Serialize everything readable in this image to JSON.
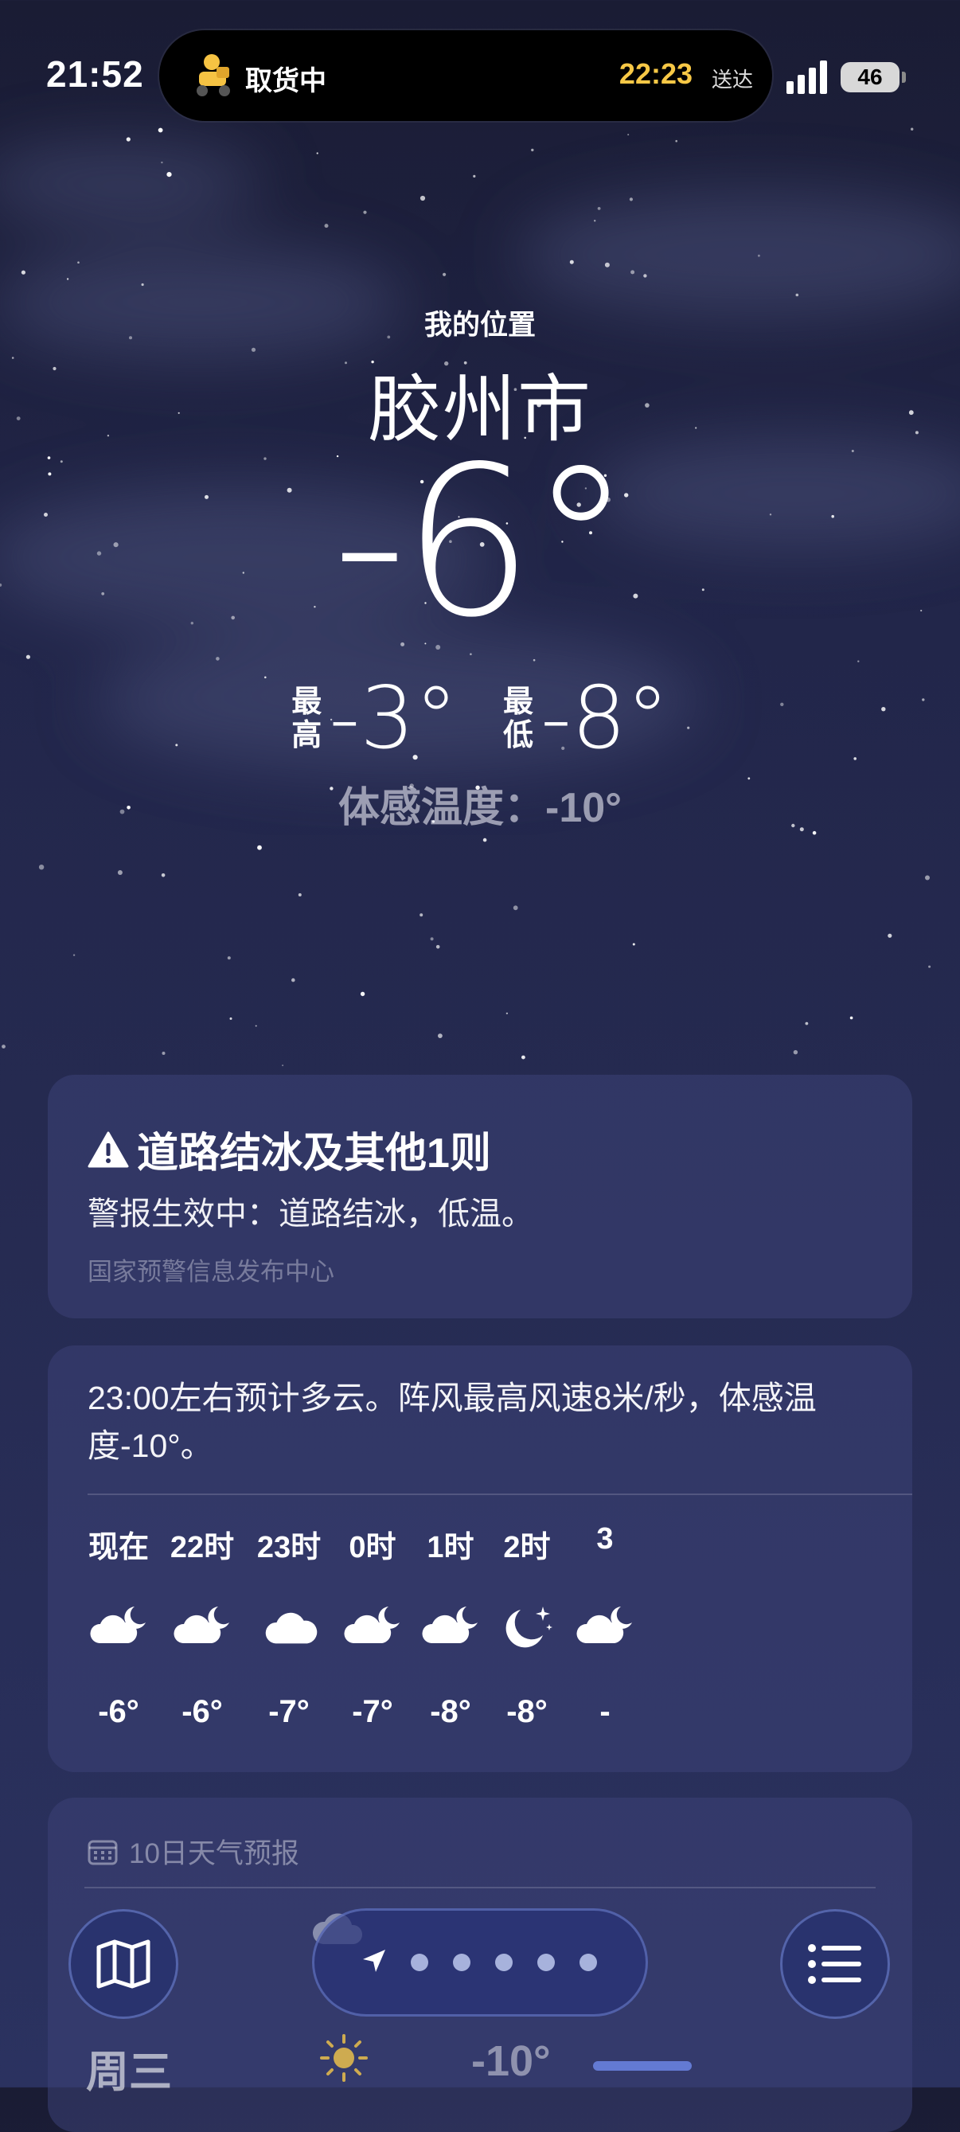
{
  "status_bar": {
    "time": "21:52",
    "island_label": "取货中",
    "island_eta": "22:23",
    "island_eta_suffix": "送达",
    "battery": "46"
  },
  "header": {
    "location_label": "我的位置",
    "city": "胶州市",
    "current_temp": "-6°",
    "high_label": "最高",
    "high_value": "-3°",
    "low_label": "最低",
    "low_value": "-8°",
    "feels_like": "体感温度：-10°"
  },
  "alert": {
    "title": "道路结冰及其他1则",
    "body": "警报生效中：道路结冰，低温。",
    "source": "国家预警信息发布中心",
    "icon": "warning-triangle-icon"
  },
  "hourly": {
    "summary": "23:00左右预计多云。阵风最高风速8米/秒，体感温度-10°。",
    "items": [
      {
        "label": "现在",
        "icon": "partly-cloudy-night-icon",
        "temp": "-6°"
      },
      {
        "label": "22时",
        "icon": "partly-cloudy-night-icon",
        "temp": "-6°"
      },
      {
        "label": "23时",
        "icon": "cloud-icon",
        "temp": "-7°"
      },
      {
        "label": "0时",
        "icon": "partly-cloudy-night-icon",
        "temp": "-7°"
      },
      {
        "label": "1时",
        "icon": "partly-cloudy-night-icon",
        "temp": "-8°"
      },
      {
        "label": "2时",
        "icon": "clear-night-icon",
        "temp": "-8°"
      },
      {
        "label": "3",
        "icon": "partly-cloudy-night-icon",
        "temp": "-"
      }
    ]
  },
  "ten_day": {
    "header": "10日天气预报",
    "first_row": {
      "day": "周三",
      "icon": "sun-icon",
      "low": "-10°"
    }
  },
  "colors": {
    "eta": "#f7c846",
    "accent_bar": "#7896ff"
  }
}
